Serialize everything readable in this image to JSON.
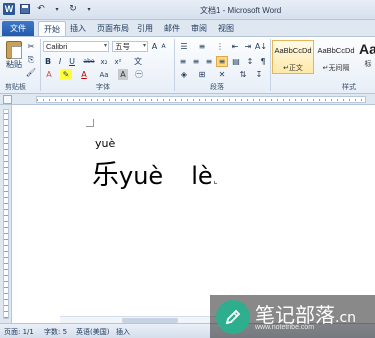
{
  "window": {
    "title": "文档1 - Microsoft Word"
  },
  "tabs": {
    "file": "文件",
    "items": [
      "开始",
      "插入",
      "页面布局",
      "引用",
      "邮件",
      "审阅",
      "视图"
    ]
  },
  "ribbon": {
    "clipboard": {
      "paste": "粘贴",
      "label": "剪贴板"
    },
    "font": {
      "name": "Calibri",
      "size": "五号",
      "label": "字体",
      "buttons": [
        "B",
        "I",
        "U",
        "abe",
        "x₂",
        "x²",
        "A",
        "Aa",
        "A"
      ]
    },
    "paragraph": {
      "label": "段落"
    },
    "styles": {
      "label": "样式",
      "items": [
        {
          "sample": "AaBbCcDd",
          "name": "正文"
        },
        {
          "sample": "AaBbCcDd",
          "name": "无间隔"
        },
        {
          "sample": "Aa",
          "name": "标"
        }
      ]
    }
  },
  "document": {
    "ruby": "yuè",
    "base": "乐",
    "pinyin1": "yuè",
    "pinyin2": "lè"
  },
  "status": {
    "page": "页面: 1/1",
    "words": "字数: 5",
    "language": "英语(美国)",
    "mode": "插入"
  },
  "watermark": {
    "title": "笔记部落",
    "url": "www.notetribe.com",
    "suffix": ".cn"
  },
  "colors": {
    "brand": "#2b5797",
    "ribbon_bg": "#fdfeff",
    "watermark_logo": "#2fae8d"
  }
}
